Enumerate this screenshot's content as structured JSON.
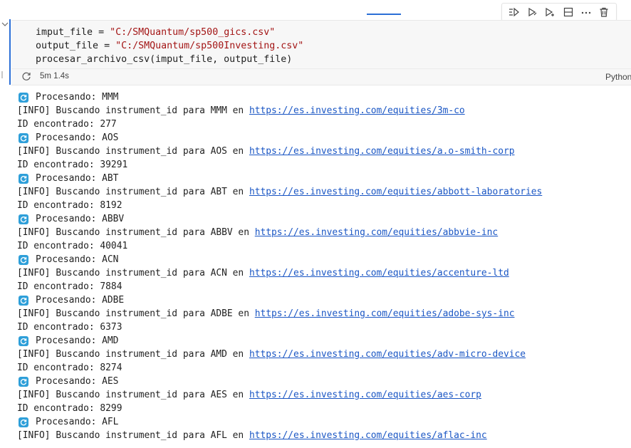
{
  "toolbar": {
    "buttons": [
      {
        "name": "run-by-line-button",
        "icon": "run-by-line-icon"
      },
      {
        "name": "execute-above-button",
        "icon": "execute-above-icon"
      },
      {
        "name": "execute-below-button",
        "icon": "execute-below-icon"
      },
      {
        "name": "split-cell-button",
        "icon": "split-cell-icon"
      },
      {
        "name": "more-actions-button",
        "icon": "ellipsis-icon"
      },
      {
        "name": "delete-cell-button",
        "icon": "trash-icon"
      }
    ]
  },
  "cell": {
    "code": {
      "line1": {
        "var": "imput_file",
        "op": " = ",
        "str": "\"C:/SMQuantum/sp500_gics.csv\""
      },
      "line2": {
        "var": "output_file",
        "op": " = ",
        "str": "\"C:/SMQuantum/sp500Investing.csv\""
      },
      "line3": "procesar_archivo_csv(imput_file, output_file)"
    },
    "exec_time": "5m 1.4s",
    "language": "Python"
  },
  "output": {
    "accent_color": "#2e9fd9",
    "entries": [
      {
        "processing": "Procesando: MMM",
        "info": "[INFO] Buscando instrument_id para MMM en ",
        "url": "https://es.investing.com/equities/3m-co",
        "id": "ID encontrado: 277"
      },
      {
        "processing": "Procesando: AOS",
        "info": "[INFO] Buscando instrument_id para AOS en ",
        "url": "https://es.investing.com/equities/a.o-smith-corp",
        "id": "ID encontrado: 39291"
      },
      {
        "processing": "Procesando: ABT",
        "info": "[INFO] Buscando instrument_id para ABT en ",
        "url": "https://es.investing.com/equities/abbott-laboratories",
        "id": "ID encontrado: 8192"
      },
      {
        "processing": "Procesando: ABBV",
        "info": "[INFO] Buscando instrument_id para ABBV en ",
        "url": "https://es.investing.com/equities/abbvie-inc",
        "id": "ID encontrado: 40041"
      },
      {
        "processing": "Procesando: ACN",
        "info": "[INFO] Buscando instrument_id para ACN en ",
        "url": "https://es.investing.com/equities/accenture-ltd",
        "id": "ID encontrado: 7884"
      },
      {
        "processing": "Procesando: ADBE",
        "info": "[INFO] Buscando instrument_id para ADBE en ",
        "url": "https://es.investing.com/equities/adobe-sys-inc",
        "id": "ID encontrado: 6373"
      },
      {
        "processing": "Procesando: AMD",
        "info": "[INFO] Buscando instrument_id para AMD en ",
        "url": "https://es.investing.com/equities/adv-micro-device",
        "id": "ID encontrado: 8274"
      },
      {
        "processing": "Procesando: AES",
        "info": "[INFO] Buscando instrument_id para AES en ",
        "url": "https://es.investing.com/equities/aes-corp",
        "id": "ID encontrado: 8299"
      },
      {
        "processing": "Procesando: AFL",
        "info": "[INFO] Buscando instrument_id para AFL en ",
        "url": "https://es.investing.com/equities/aflac-inc",
        "id": ""
      }
    ]
  }
}
